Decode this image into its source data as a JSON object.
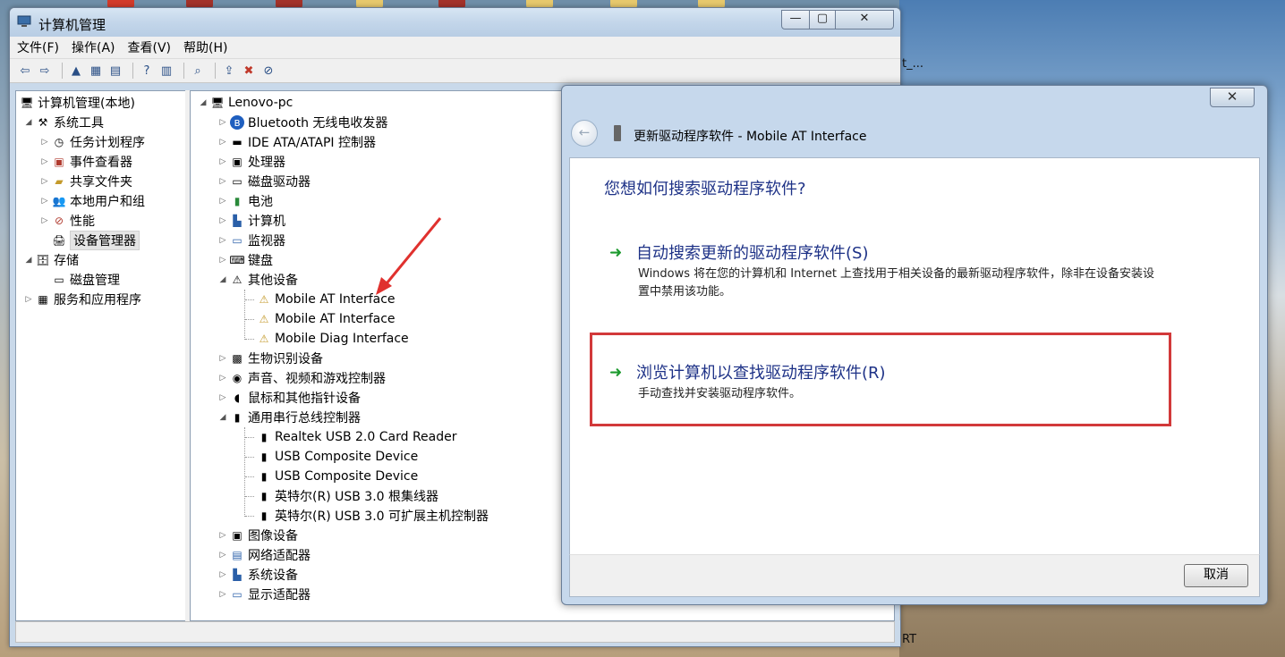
{
  "desktop": {
    "bg_text_1": "t_...",
    "bg_text_2": "RT"
  },
  "window": {
    "title": "计算机管理",
    "controls": {
      "minimize": "—",
      "maximize": "▢",
      "close": "✕"
    }
  },
  "menu": [
    "文件(F)",
    "操作(A)",
    "查看(V)",
    "帮助(H)"
  ],
  "left_tree": {
    "root": "计算机管理(本地)",
    "system_tools": "系统工具",
    "task_scheduler": "任务计划程序",
    "event_viewer": "事件查看器",
    "shared_folders": "共享文件夹",
    "local_users": "本地用户和组",
    "performance": "性能",
    "device_manager": "设备管理器",
    "storage": "存储",
    "disk_management": "磁盘管理",
    "services_apps": "服务和应用程序"
  },
  "device_tree": {
    "root": "Lenovo-pc",
    "categories": [
      "Bluetooth 无线电收发器",
      "IDE ATA/ATAPI 控制器",
      "处理器",
      "磁盘驱动器",
      "电池",
      "计算机",
      "监视器",
      "键盘",
      "其他设备"
    ],
    "other_devices": [
      "Mobile AT Interface",
      "Mobile AT Interface",
      "Mobile Diag Interface"
    ],
    "categories_2": [
      "生物识别设备",
      "声音、视频和游戏控制器",
      "鼠标和其他指针设备",
      "通用串行总线控制器"
    ],
    "usb_devices": [
      "Realtek USB 2.0 Card Reader",
      "USB Composite Device",
      "USB Composite Device",
      "英特尔(R) USB 3.0 根集线器",
      "英特尔(R) USB 3.0 可扩展主机控制器"
    ],
    "categories_3": [
      "图像设备",
      "网络适配器",
      "系统设备",
      "显示适配器"
    ]
  },
  "dialog": {
    "close": "✕",
    "title": "更新驱动程序软件 - Mobile AT Interface",
    "question": "您想如何搜索驱动程序软件?",
    "option_auto": {
      "title": "自动搜索更新的驱动程序软件(S)",
      "desc": "Windows 将在您的计算机和 Internet 上查找用于相关设备的最新驱动程序软件，除非在设备安装设置中禁用该功能。"
    },
    "option_browse": {
      "title": "浏览计算机以查找驱动程序软件(R)",
      "desc": "手动查找并安装驱动程序软件。"
    },
    "cancel": "取消",
    "highlight_color": "#d2393a"
  }
}
